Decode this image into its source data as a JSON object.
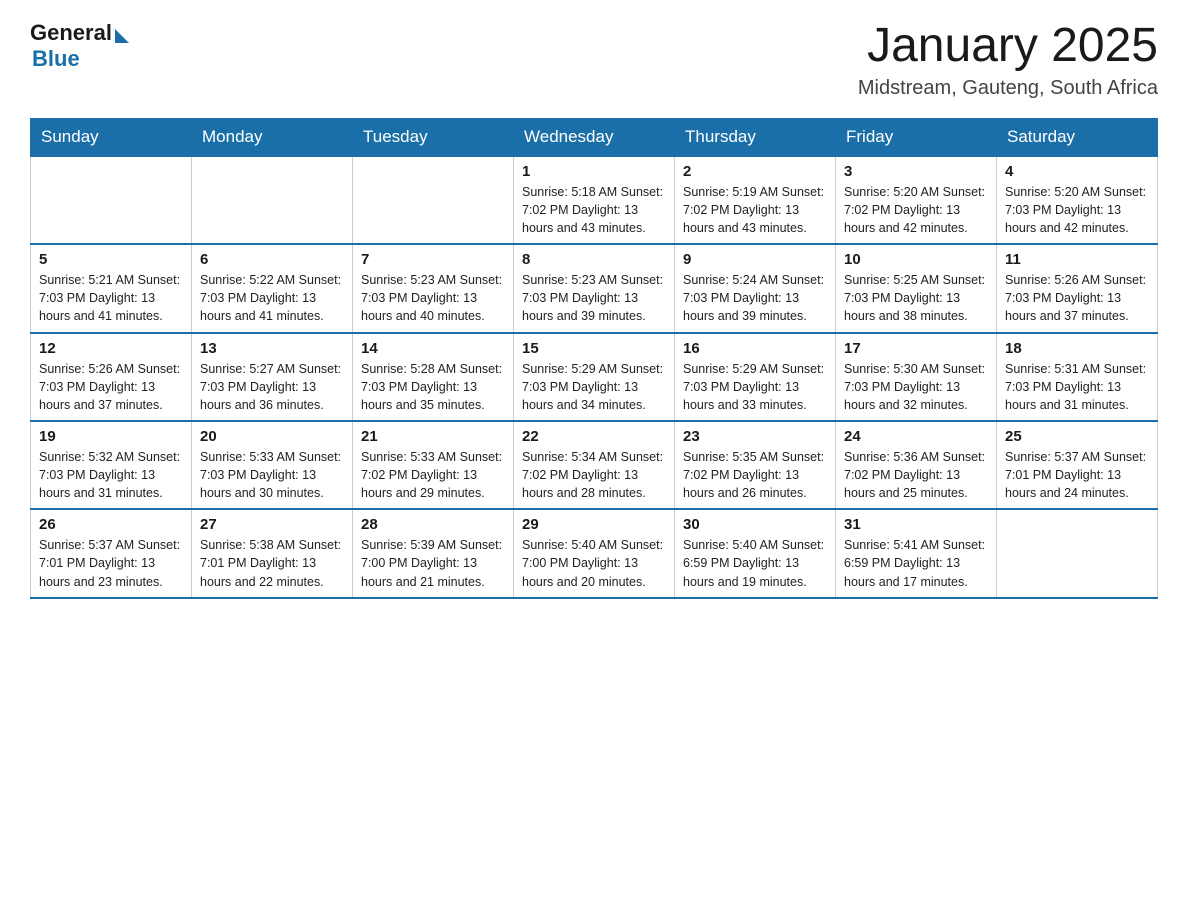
{
  "header": {
    "logo_general": "General",
    "logo_blue": "Blue",
    "month_title": "January 2025",
    "location": "Midstream, Gauteng, South Africa"
  },
  "weekdays": [
    "Sunday",
    "Monday",
    "Tuesday",
    "Wednesday",
    "Thursday",
    "Friday",
    "Saturday"
  ],
  "weeks": [
    [
      {
        "day": "",
        "info": ""
      },
      {
        "day": "",
        "info": ""
      },
      {
        "day": "",
        "info": ""
      },
      {
        "day": "1",
        "info": "Sunrise: 5:18 AM\nSunset: 7:02 PM\nDaylight: 13 hours\nand 43 minutes."
      },
      {
        "day": "2",
        "info": "Sunrise: 5:19 AM\nSunset: 7:02 PM\nDaylight: 13 hours\nand 43 minutes."
      },
      {
        "day": "3",
        "info": "Sunrise: 5:20 AM\nSunset: 7:02 PM\nDaylight: 13 hours\nand 42 minutes."
      },
      {
        "day": "4",
        "info": "Sunrise: 5:20 AM\nSunset: 7:03 PM\nDaylight: 13 hours\nand 42 minutes."
      }
    ],
    [
      {
        "day": "5",
        "info": "Sunrise: 5:21 AM\nSunset: 7:03 PM\nDaylight: 13 hours\nand 41 minutes."
      },
      {
        "day": "6",
        "info": "Sunrise: 5:22 AM\nSunset: 7:03 PM\nDaylight: 13 hours\nand 41 minutes."
      },
      {
        "day": "7",
        "info": "Sunrise: 5:23 AM\nSunset: 7:03 PM\nDaylight: 13 hours\nand 40 minutes."
      },
      {
        "day": "8",
        "info": "Sunrise: 5:23 AM\nSunset: 7:03 PM\nDaylight: 13 hours\nand 39 minutes."
      },
      {
        "day": "9",
        "info": "Sunrise: 5:24 AM\nSunset: 7:03 PM\nDaylight: 13 hours\nand 39 minutes."
      },
      {
        "day": "10",
        "info": "Sunrise: 5:25 AM\nSunset: 7:03 PM\nDaylight: 13 hours\nand 38 minutes."
      },
      {
        "day": "11",
        "info": "Sunrise: 5:26 AM\nSunset: 7:03 PM\nDaylight: 13 hours\nand 37 minutes."
      }
    ],
    [
      {
        "day": "12",
        "info": "Sunrise: 5:26 AM\nSunset: 7:03 PM\nDaylight: 13 hours\nand 37 minutes."
      },
      {
        "day": "13",
        "info": "Sunrise: 5:27 AM\nSunset: 7:03 PM\nDaylight: 13 hours\nand 36 minutes."
      },
      {
        "day": "14",
        "info": "Sunrise: 5:28 AM\nSunset: 7:03 PM\nDaylight: 13 hours\nand 35 minutes."
      },
      {
        "day": "15",
        "info": "Sunrise: 5:29 AM\nSunset: 7:03 PM\nDaylight: 13 hours\nand 34 minutes."
      },
      {
        "day": "16",
        "info": "Sunrise: 5:29 AM\nSunset: 7:03 PM\nDaylight: 13 hours\nand 33 minutes."
      },
      {
        "day": "17",
        "info": "Sunrise: 5:30 AM\nSunset: 7:03 PM\nDaylight: 13 hours\nand 32 minutes."
      },
      {
        "day": "18",
        "info": "Sunrise: 5:31 AM\nSunset: 7:03 PM\nDaylight: 13 hours\nand 31 minutes."
      }
    ],
    [
      {
        "day": "19",
        "info": "Sunrise: 5:32 AM\nSunset: 7:03 PM\nDaylight: 13 hours\nand 31 minutes."
      },
      {
        "day": "20",
        "info": "Sunrise: 5:33 AM\nSunset: 7:03 PM\nDaylight: 13 hours\nand 30 minutes."
      },
      {
        "day": "21",
        "info": "Sunrise: 5:33 AM\nSunset: 7:02 PM\nDaylight: 13 hours\nand 29 minutes."
      },
      {
        "day": "22",
        "info": "Sunrise: 5:34 AM\nSunset: 7:02 PM\nDaylight: 13 hours\nand 28 minutes."
      },
      {
        "day": "23",
        "info": "Sunrise: 5:35 AM\nSunset: 7:02 PM\nDaylight: 13 hours\nand 26 minutes."
      },
      {
        "day": "24",
        "info": "Sunrise: 5:36 AM\nSunset: 7:02 PM\nDaylight: 13 hours\nand 25 minutes."
      },
      {
        "day": "25",
        "info": "Sunrise: 5:37 AM\nSunset: 7:01 PM\nDaylight: 13 hours\nand 24 minutes."
      }
    ],
    [
      {
        "day": "26",
        "info": "Sunrise: 5:37 AM\nSunset: 7:01 PM\nDaylight: 13 hours\nand 23 minutes."
      },
      {
        "day": "27",
        "info": "Sunrise: 5:38 AM\nSunset: 7:01 PM\nDaylight: 13 hours\nand 22 minutes."
      },
      {
        "day": "28",
        "info": "Sunrise: 5:39 AM\nSunset: 7:00 PM\nDaylight: 13 hours\nand 21 minutes."
      },
      {
        "day": "29",
        "info": "Sunrise: 5:40 AM\nSunset: 7:00 PM\nDaylight: 13 hours\nand 20 minutes."
      },
      {
        "day": "30",
        "info": "Sunrise: 5:40 AM\nSunset: 6:59 PM\nDaylight: 13 hours\nand 19 minutes."
      },
      {
        "day": "31",
        "info": "Sunrise: 5:41 AM\nSunset: 6:59 PM\nDaylight: 13 hours\nand 17 minutes."
      },
      {
        "day": "",
        "info": ""
      }
    ]
  ]
}
